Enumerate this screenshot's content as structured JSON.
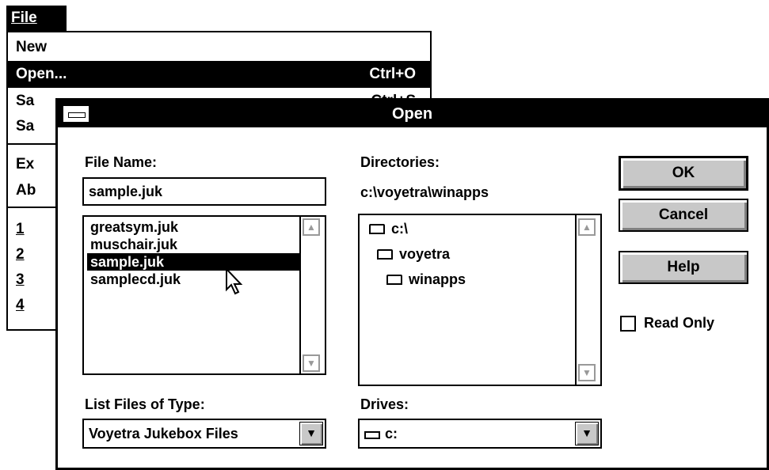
{
  "menu": {
    "title": "File",
    "items": [
      {
        "label": "New",
        "shortcut": ""
      },
      {
        "label": "Open...",
        "shortcut": "Ctrl+O"
      },
      {
        "label": "Sa",
        "shortcut": "Ctrl+S"
      },
      {
        "label": "Sa",
        "shortcut": ""
      },
      {
        "label": "Ex",
        "shortcut": ""
      },
      {
        "label": "Ab",
        "shortcut": ""
      },
      {
        "label": "1",
        "shortcut": ""
      },
      {
        "label": "2",
        "shortcut": ""
      },
      {
        "label": "3",
        "shortcut": ""
      },
      {
        "label": "4",
        "shortcut": ""
      }
    ]
  },
  "dialog": {
    "title": "Open",
    "file_name_label": "File Name:",
    "file_name_value": "sample.juk",
    "files": [
      "greatsym.juk",
      "muschair.juk",
      "sample.juk",
      "samplecd.juk"
    ],
    "selected_file": "sample.juk",
    "directories_label": "Directories:",
    "current_directory": "c:\\voyetra\\winapps",
    "directories": [
      "c:\\",
      "voyetra",
      "winapps"
    ],
    "list_type_label": "List Files of Type:",
    "list_type_value": "Voyetra Jukebox Files",
    "drives_label": "Drives:",
    "drive_value": "c:",
    "ok_label": "OK",
    "cancel_label": "Cancel",
    "help_label": "Help",
    "read_only_label": "Read Only",
    "read_only_checked": false
  }
}
